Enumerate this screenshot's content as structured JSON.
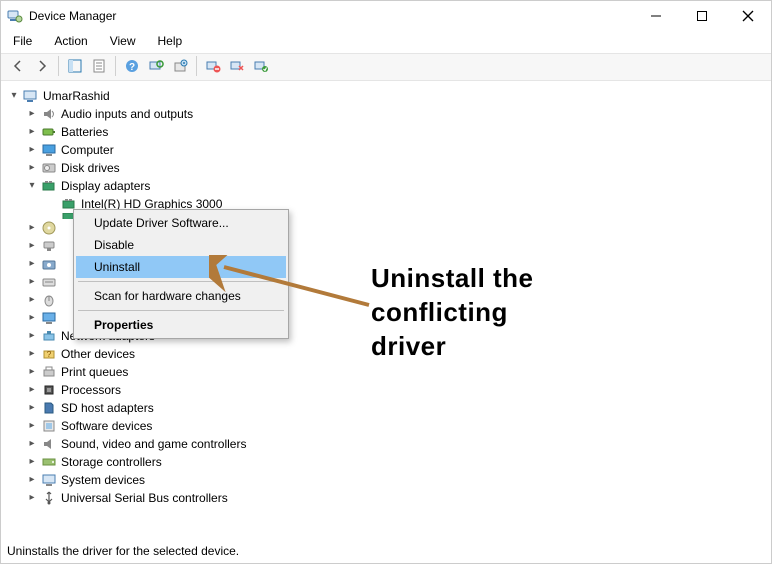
{
  "window": {
    "title": "Device Manager"
  },
  "menu": {
    "file": "File",
    "action": "Action",
    "view": "View",
    "help": "Help"
  },
  "tree": {
    "root": "UmarRashid",
    "audio": "Audio inputs and outputs",
    "batteries": "Batteries",
    "computer": "Computer",
    "disk": "Disk drives",
    "display": "Display adapters",
    "display_child": "Intel(R) HD Graphics 3000",
    "network": "Network adapters",
    "other": "Other devices",
    "print": "Print queues",
    "processors": "Processors",
    "sdhost": "SD host adapters",
    "software": "Software devices",
    "sound": "Sound, video and game controllers",
    "storage": "Storage controllers",
    "system": "System devices",
    "usb": "Universal Serial Bus controllers"
  },
  "context_menu": {
    "update": "Update Driver Software...",
    "disable": "Disable",
    "uninstall": "Uninstall",
    "scan": "Scan for hardware changes",
    "properties": "Properties"
  },
  "annotation": {
    "line1": "Uninstall the",
    "line2": "conflicting",
    "line3": "driver"
  },
  "status": "Uninstalls the driver for the selected device."
}
